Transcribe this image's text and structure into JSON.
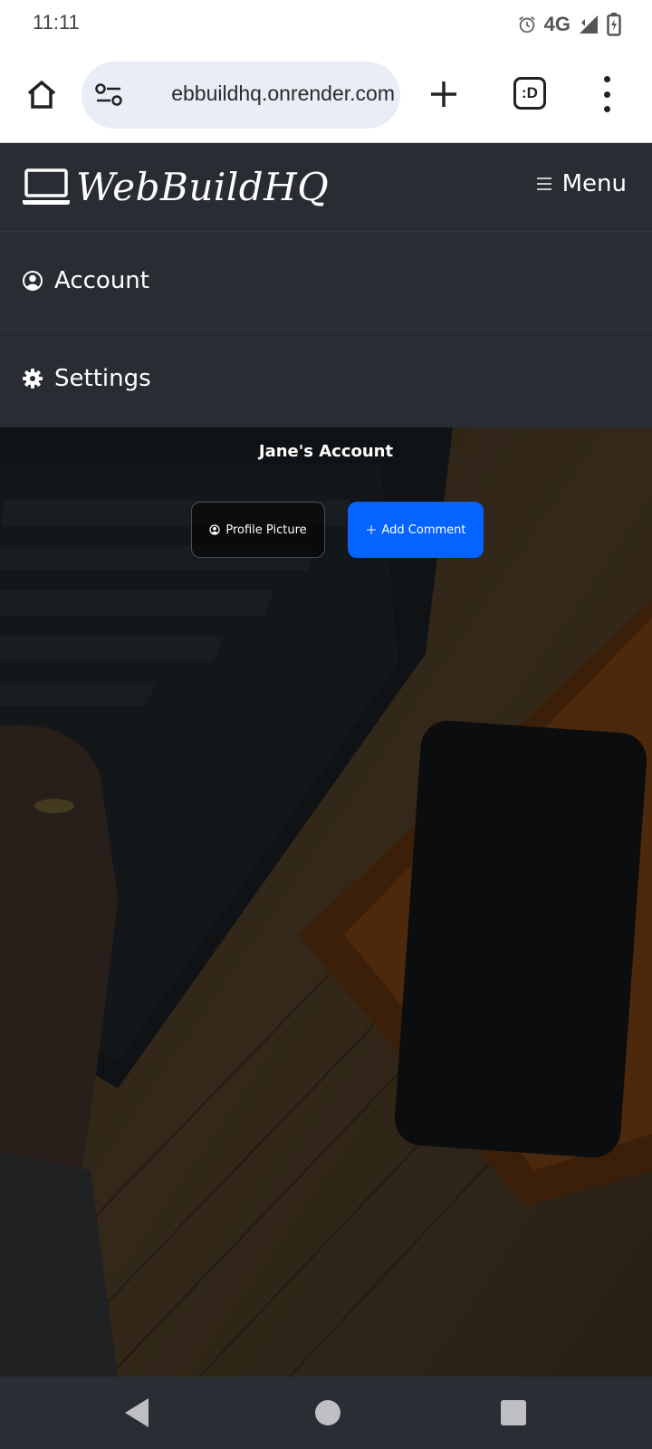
{
  "status_bar": {
    "time": "11:11",
    "network": "4G",
    "icons": [
      "alarm-icon",
      "signal-icon",
      "battery-charging-icon"
    ]
  },
  "browser": {
    "url": "ebbuildhq.onrender.com",
    "tab_switcher_label": ":D",
    "icons": [
      "home-icon",
      "site-info-icon",
      "new-tab-icon",
      "tab-switcher-icon",
      "more-vert-icon"
    ]
  },
  "site": {
    "brand": "WebBuildHQ",
    "menu_label": "Menu",
    "nav_items": [
      {
        "label": "Account",
        "icon": "user-circle-icon"
      },
      {
        "label": "Settings",
        "icon": "gear-icon"
      }
    ]
  },
  "hero": {
    "title": "Jane's Account",
    "profile_button_label": "Profile Picture",
    "add_comment_label": "Add Comment"
  },
  "colors": {
    "navbar_bg": "#292d33",
    "primary": "#0563ff",
    "url_pill_bg": "#e9edf6",
    "system_nav_bg": "#2a2e34"
  }
}
